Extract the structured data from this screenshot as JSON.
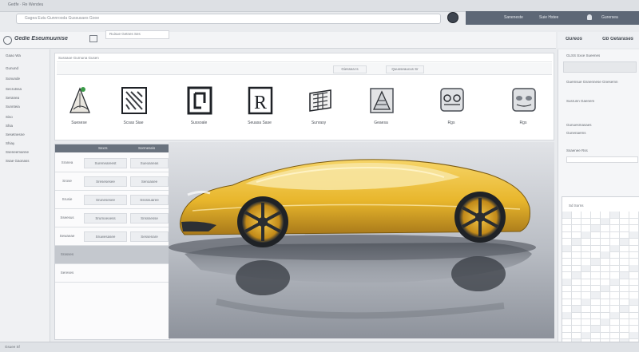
{
  "titlebar": {
    "crumbs": "Gedfe  ·  Re  Wendeu"
  },
  "search": {
    "text": "Gagea Eutu Gunnrooda Gussusaes Gooe"
  },
  "account": {
    "label_a": "Saneneste",
    "label_b": "Suie  Hstee",
    "icon_b": "user-icon",
    "label_c": "Gurersea"
  },
  "menubar": {
    "brand": "Gedie  Eseumuunise",
    "tab": "Ruisue  Getnes  Ses"
  },
  "right_head": {
    "a": "Gureos",
    "b": "Gb  Getarases"
  },
  "nav": {
    "items": [
      "Gaao Wa",
      "Gunund",
      "Sonunde",
      "Secrutssa",
      "Seranea",
      "Sunnteia",
      "Siso",
      "Shia",
      "Sesetnesne",
      "Shiay",
      "Sseneemanne",
      "Ssae Gaonass"
    ]
  },
  "toolbar": {
    "address": "Sussaoe  Gurnuna  Gusen",
    "tabs": [
      "Giessea  Is",
      "Quusseaucus  Sr"
    ],
    "tools": [
      {
        "label": "Suesese",
        "icon": "sketch-cone-icon"
      },
      {
        "label": "Scsas Siae",
        "icon": "pattern-grid-icon"
      },
      {
        "label": "Sussoale",
        "icon": "bracket-frame-icon"
      },
      {
        "label": "Seuasa  Sase",
        "icon": "letter-r-icon"
      },
      {
        "label": "Sunrasy",
        "icon": "layers-stack-icon"
      },
      {
        "label": "Geaesa",
        "icon": "texture-triangle-icon"
      },
      {
        "label": "Rgs",
        "icon": "surface-mesh-icon"
      },
      {
        "label": "Rgs",
        "icon": "shading-mesh-icon"
      }
    ]
  },
  "table": {
    "header": [
      "Sexrs",
      "Sormeseis"
    ],
    "rows": [
      [
        "Sranea",
        "Sureneareest",
        "Sueoaneas"
      ],
      [
        "Srose",
        "Sresesesee",
        "Senoasee"
      ],
      [
        "Srusie",
        "Srunesesee",
        "Sssssuaree"
      ],
      [
        "Sseesus",
        "Srumoeoess",
        "Snsssesse"
      ],
      [
        "Sewaeae",
        "Sruwesasee",
        "Sessenare"
      ],
      [
        "Srasses",
        "",
        ""
      ],
      [
        "Sereses",
        "",
        ""
      ]
    ]
  },
  "rightpanel": {
    "lines": [
      "GLSS  Sxxe  Sueenes",
      "Guemsue Gsnennese  Gnesemn",
      "Susrunn Gaeners",
      "Gunuesmasaes",
      "Gunenaems",
      "Ssaenee  Rss"
    ],
    "grid_caption": "Sd  Sorns"
  },
  "status": {
    "text": "Gsuee  Sf"
  },
  "colors": {
    "accent": "#e8b62c",
    "chrome": "#5d6776"
  }
}
